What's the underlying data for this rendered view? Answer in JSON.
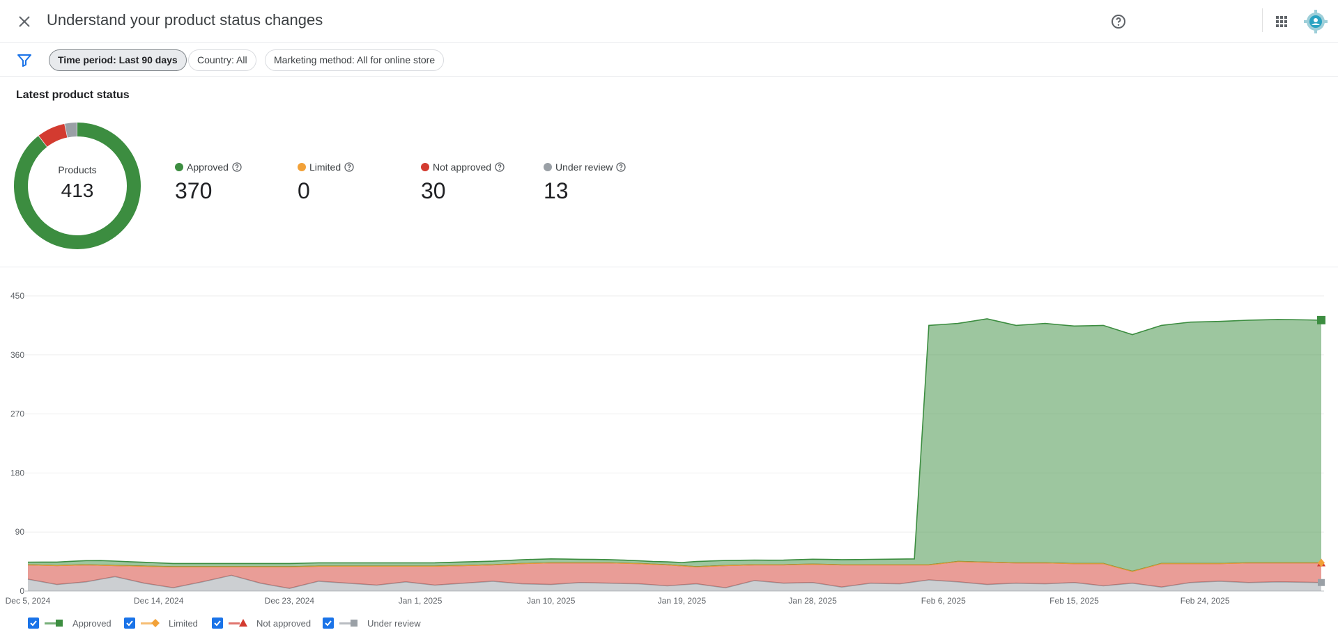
{
  "header": {
    "title": "Understand your product status changes"
  },
  "filters": {
    "chips": [
      {
        "label": "Time period: Last 90 days",
        "active": true
      },
      {
        "label": "Country: All",
        "active": false
      },
      {
        "label": "Marketing method: All for online store",
        "active": false
      }
    ]
  },
  "summary": {
    "title": "Latest product status",
    "donut_label": "Products",
    "total": "413",
    "stats": [
      {
        "label": "Approved",
        "value": "370",
        "color": "#3c8d40"
      },
      {
        "label": "Limited",
        "value": "0",
        "color": "#f2a138"
      },
      {
        "label": "Not approved",
        "value": "30",
        "color": "#d33b30"
      },
      {
        "label": "Under review",
        "value": "13",
        "color": "#9aa0a6"
      }
    ]
  },
  "chart_data": {
    "type": "area",
    "stacked": true,
    "ylim": [
      0,
      450
    ],
    "yticks": [
      "0",
      "90",
      "180",
      "270",
      "360",
      "450"
    ],
    "xticks": [
      "Dec 5, 2024",
      "Dec 14, 2024",
      "Dec 23, 2024",
      "Jan 1, 2025",
      "Jan 10, 2025",
      "Jan 19, 2025",
      "Jan 28, 2025",
      "Feb 6, 2025",
      "Feb 15, 2025",
      "Feb 24, 2025"
    ],
    "x_start": "2024-12-05",
    "x_end": "2025-03-04",
    "grid": true,
    "series": [
      {
        "name": "Under review",
        "color": "#9aa0a6",
        "points": [
          [
            "2024-12-05",
            18
          ],
          [
            "2024-12-07",
            10
          ],
          [
            "2024-12-09",
            14
          ],
          [
            "2024-12-11",
            22
          ],
          [
            "2024-12-13",
            12
          ],
          [
            "2024-12-15",
            5
          ],
          [
            "2024-12-17",
            14
          ],
          [
            "2024-12-19",
            24
          ],
          [
            "2024-12-21",
            12
          ],
          [
            "2024-12-23",
            4
          ],
          [
            "2024-12-25",
            15
          ],
          [
            "2024-12-27",
            12
          ],
          [
            "2024-12-29",
            9
          ],
          [
            "2024-12-31",
            14
          ],
          [
            "2025-01-02",
            9
          ],
          [
            "2025-01-04",
            12
          ],
          [
            "2025-01-06",
            15
          ],
          [
            "2025-01-08",
            11
          ],
          [
            "2025-01-10",
            10
          ],
          [
            "2025-01-12",
            13
          ],
          [
            "2025-01-14",
            12
          ],
          [
            "2025-01-16",
            11
          ],
          [
            "2025-01-18",
            8
          ],
          [
            "2025-01-20",
            11
          ],
          [
            "2025-01-22",
            5
          ],
          [
            "2025-01-24",
            16
          ],
          [
            "2025-01-26",
            12
          ],
          [
            "2025-01-28",
            13
          ],
          [
            "2025-01-30",
            6
          ],
          [
            "2025-02-01",
            12
          ],
          [
            "2025-02-03",
            11
          ],
          [
            "2025-02-05",
            17
          ],
          [
            "2025-02-07",
            14
          ],
          [
            "2025-02-09",
            10
          ],
          [
            "2025-02-11",
            12
          ],
          [
            "2025-02-13",
            11
          ],
          [
            "2025-02-15",
            13
          ],
          [
            "2025-02-17",
            8
          ],
          [
            "2025-02-19",
            12
          ],
          [
            "2025-02-21",
            6
          ],
          [
            "2025-02-23",
            13
          ],
          [
            "2025-02-25",
            15
          ],
          [
            "2025-02-27",
            13
          ],
          [
            "2025-03-01",
            14
          ],
          [
            "2025-03-04",
            13
          ]
        ]
      },
      {
        "name": "Not approved",
        "color": "#d33b30",
        "points": [
          [
            "2024-12-05",
            22
          ],
          [
            "2024-12-07",
            29
          ],
          [
            "2024-12-09",
            26
          ],
          [
            "2024-12-11",
            17
          ],
          [
            "2024-12-13",
            26
          ],
          [
            "2024-12-15",
            32
          ],
          [
            "2024-12-17",
            23
          ],
          [
            "2024-12-19",
            13
          ],
          [
            "2024-12-21",
            25
          ],
          [
            "2024-12-23",
            33
          ],
          [
            "2024-12-25",
            23
          ],
          [
            "2024-12-27",
            26
          ],
          [
            "2024-12-29",
            29
          ],
          [
            "2024-12-31",
            24
          ],
          [
            "2025-01-02",
            29
          ],
          [
            "2025-01-04",
            27
          ],
          [
            "2025-01-06",
            25
          ],
          [
            "2025-01-08",
            31
          ],
          [
            "2025-01-10",
            33
          ],
          [
            "2025-01-12",
            30
          ],
          [
            "2025-01-14",
            31
          ],
          [
            "2025-01-16",
            31
          ],
          [
            "2025-01-18",
            32
          ],
          [
            "2025-01-20",
            26
          ],
          [
            "2025-01-22",
            34
          ],
          [
            "2025-01-24",
            24
          ],
          [
            "2025-01-26",
            28
          ],
          [
            "2025-01-28",
            28
          ],
          [
            "2025-01-30",
            34
          ],
          [
            "2025-02-01",
            28
          ],
          [
            "2025-02-03",
            29
          ],
          [
            "2025-02-05",
            23
          ],
          [
            "2025-02-07",
            31
          ],
          [
            "2025-02-09",
            34
          ],
          [
            "2025-02-11",
            31
          ],
          [
            "2025-02-13",
            32
          ],
          [
            "2025-02-15",
            29
          ],
          [
            "2025-02-17",
            34
          ],
          [
            "2025-02-19",
            18
          ],
          [
            "2025-02-21",
            36
          ],
          [
            "2025-02-23",
            29
          ],
          [
            "2025-02-25",
            27
          ],
          [
            "2025-02-27",
            30
          ],
          [
            "2025-03-01",
            29
          ],
          [
            "2025-03-04",
            30
          ]
        ]
      },
      {
        "name": "Limited",
        "color": "#f2a138",
        "points": [
          [
            "2024-12-05",
            0
          ],
          [
            "2025-03-04",
            0
          ]
        ]
      },
      {
        "name": "Approved",
        "color": "#3c8d40",
        "points": [
          [
            "2024-12-05",
            4
          ],
          [
            "2024-12-10",
            7
          ],
          [
            "2024-12-15",
            5
          ],
          [
            "2025-01-01",
            5
          ],
          [
            "2025-01-10",
            6
          ],
          [
            "2025-01-17",
            4
          ],
          [
            "2025-01-19",
            5
          ],
          [
            "2025-01-20",
            8
          ],
          [
            "2025-01-25",
            7
          ],
          [
            "2025-01-31",
            8
          ],
          [
            "2025-02-04",
            9
          ],
          [
            "2025-02-05",
            365
          ],
          [
            "2025-02-07",
            363
          ],
          [
            "2025-02-09",
            371
          ],
          [
            "2025-02-11",
            362
          ],
          [
            "2025-02-13",
            365
          ],
          [
            "2025-02-15",
            362
          ],
          [
            "2025-02-17",
            363
          ],
          [
            "2025-02-19",
            361
          ],
          [
            "2025-02-21",
            363
          ],
          [
            "2025-02-23",
            368
          ],
          [
            "2025-02-25",
            369
          ],
          [
            "2025-02-27",
            370
          ],
          [
            "2025-03-01",
            371
          ],
          [
            "2025-03-04",
            370
          ]
        ]
      }
    ]
  },
  "legend": [
    {
      "label": "Approved",
      "color": "#3c8d40",
      "marker": "square"
    },
    {
      "label": "Limited",
      "color": "#f2a138",
      "marker": "diamond"
    },
    {
      "label": "Not approved",
      "color": "#d33b30",
      "marker": "triangle"
    },
    {
      "label": "Under review",
      "color": "#9aa0a6",
      "marker": "square"
    }
  ]
}
